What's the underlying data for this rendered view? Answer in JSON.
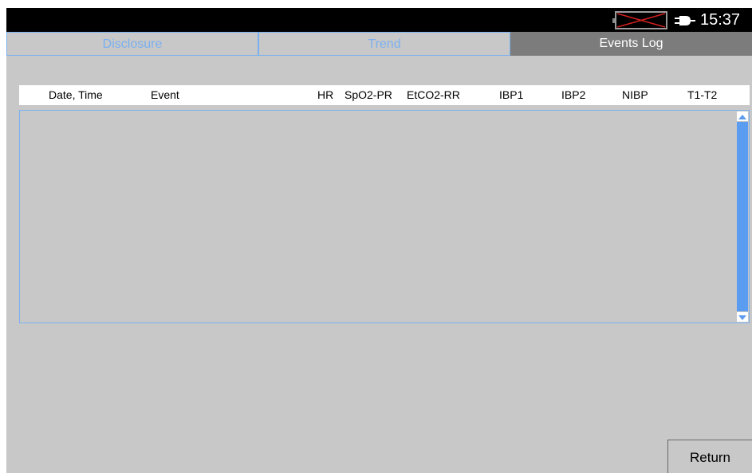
{
  "status_bar": {
    "time": "15:37",
    "battery_icon": "battery-disconnected-icon",
    "power_icon": "power-plug-icon"
  },
  "tabs": [
    {
      "label": "Disclosure",
      "active": false
    },
    {
      "label": "Trend",
      "active": false
    },
    {
      "label": "Events Log",
      "active": true
    }
  ],
  "events_table": {
    "columns": [
      "Date, Time",
      "Event",
      "HR",
      "SpO2-PR",
      "EtCO2-RR",
      "IBP1",
      "IBP2",
      "NIBP",
      "T1-T2"
    ],
    "rows": []
  },
  "buttons": {
    "return_label": "Return"
  },
  "colors": {
    "accent": "#7ab0f0",
    "scrollbar": "#5a9cf0",
    "background": "#c8c8c8",
    "active_tab": "#7c7c7c"
  }
}
